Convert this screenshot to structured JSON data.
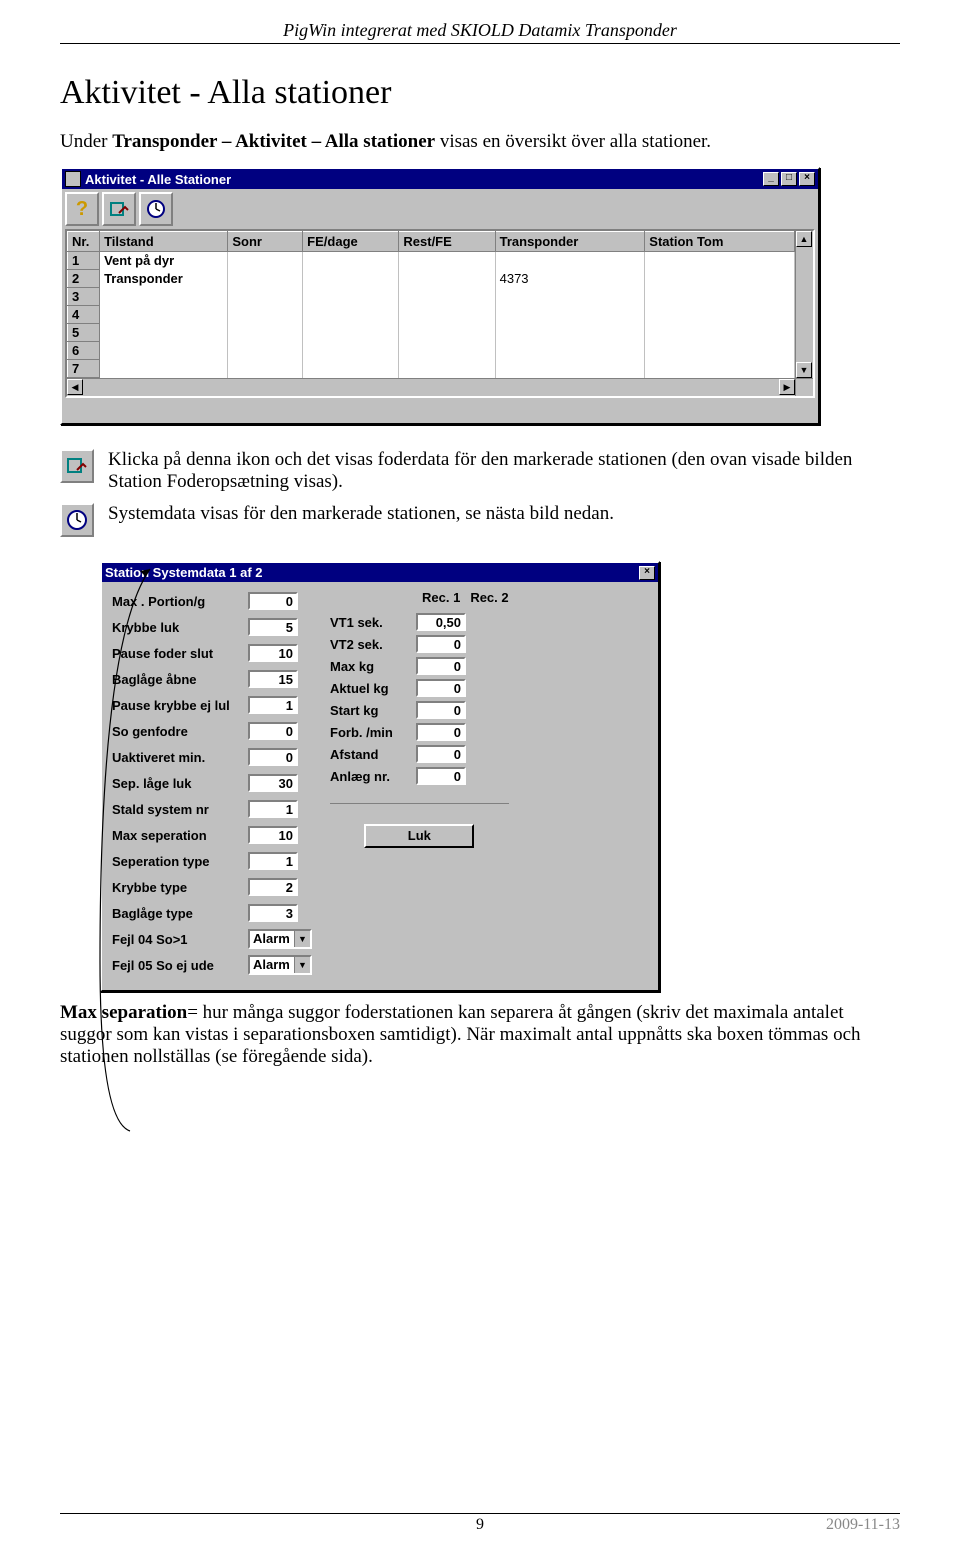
{
  "doc": {
    "header": "PigWin integrerat med SKIOLD Datamix Transponder",
    "h1": "Aktivitet - Alla stationer",
    "intro_pre": "Under ",
    "intro_bold": "Transponder – Aktivitet – Alla stationer",
    "intro_post": " visas en översikt över alla stationer.",
    "para_icon1": "Klicka på denna ikon och det visas foderdata för den markerade stationen (den ovan visade bilden Station Foderopsætning visas).",
    "para_icon2": "Systemdata visas för den markerade stationen, se nästa bild nedan.",
    "bottom_bold": "Max separation",
    "bottom_rest": "= hur många suggor foderstationen kan separera åt gången (skriv det maximala antalet suggor som kan vistas i separationsboxen samtidigt). När maximalt antal uppnåtts ska boxen tömmas och stationen nollställas (se föregående sida).",
    "page_num": "9",
    "date": "2009-11-13"
  },
  "win1": {
    "title": "Aktivitet - Alle Stationer",
    "columns": [
      "Nr.",
      "Tilstand",
      "Sonr",
      "FE/dage",
      "Rest/FE",
      "Transponder",
      "Station Tom"
    ],
    "rows": [
      {
        "nr": "1",
        "tilstand": "Vent på dyr",
        "sonr": "",
        "fe": "",
        "rest": "",
        "tr": "",
        "tom": ""
      },
      {
        "nr": "2",
        "tilstand": "Transponder",
        "sonr": "",
        "fe": "",
        "rest": "",
        "tr": "4373",
        "tom": ""
      },
      {
        "nr": "3",
        "tilstand": "",
        "sonr": "",
        "fe": "",
        "rest": "",
        "tr": "",
        "tom": ""
      },
      {
        "nr": "4",
        "tilstand": "",
        "sonr": "",
        "fe": "",
        "rest": "",
        "tr": "",
        "tom": ""
      },
      {
        "nr": "5",
        "tilstand": "",
        "sonr": "",
        "fe": "",
        "rest": "",
        "tr": "",
        "tom": ""
      },
      {
        "nr": "6",
        "tilstand": "",
        "sonr": "",
        "fe": "",
        "rest": "",
        "tr": "",
        "tom": ""
      },
      {
        "nr": "7",
        "tilstand": "",
        "sonr": "",
        "fe": "",
        "rest": "",
        "tr": "",
        "tom": ""
      }
    ]
  },
  "win2": {
    "title": "Station Systemdata 1 af 2",
    "rec1": "Rec. 1",
    "rec2": "Rec. 2",
    "left": [
      {
        "label": "Max . Portion/g",
        "val": "0"
      },
      {
        "label": "Krybbe luk",
        "val": "5"
      },
      {
        "label": "Pause foder slut",
        "val": "10"
      },
      {
        "label": "Baglåge åbne",
        "val": "15"
      },
      {
        "label": "Pause krybbe ej lul",
        "val": "1"
      },
      {
        "label": "So genfodre",
        "val": "0"
      },
      {
        "label": "Uaktiveret min.",
        "val": "0"
      },
      {
        "label": "Sep. låge luk",
        "val": "30"
      },
      {
        "label": "Stald system nr",
        "val": "1"
      },
      {
        "label": "Max seperation",
        "val": "10"
      },
      {
        "label": "Seperation type",
        "val": "1"
      },
      {
        "label": "Krybbe type",
        "val": "2"
      },
      {
        "label": "Baglåge type",
        "val": "3"
      }
    ],
    "leftSel": [
      {
        "label": "Fejl 04 So>1",
        "val": "Alarm"
      },
      {
        "label": "Fejl 05 So ej ude",
        "val": "Alarm"
      }
    ],
    "right": [
      {
        "label": "VT1 sek.",
        "val": "0,50"
      },
      {
        "label": "VT2 sek.",
        "val": "0"
      },
      {
        "label": "Max kg",
        "val": "0"
      },
      {
        "label": "Aktuel kg",
        "val": "0"
      },
      {
        "label": "Start kg",
        "val": "0"
      },
      {
        "label": "Forb. /min",
        "val": "0"
      },
      {
        "label": "Afstand",
        "val": "0"
      },
      {
        "label": "Anlæg nr.",
        "val": "0"
      }
    ],
    "luk": "Luk"
  }
}
